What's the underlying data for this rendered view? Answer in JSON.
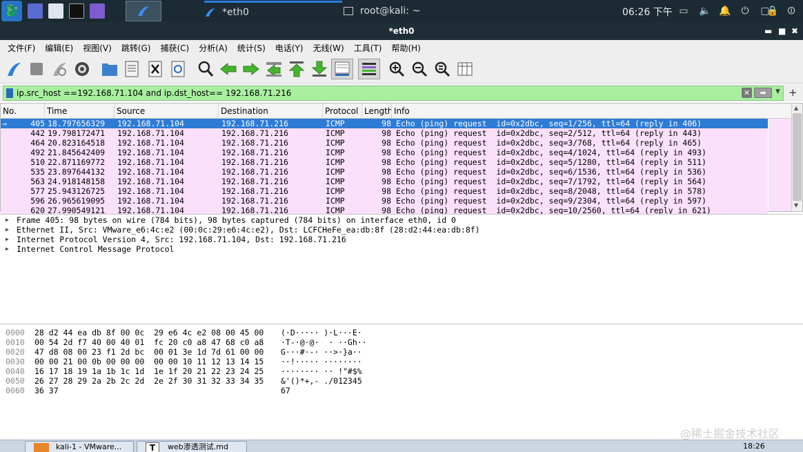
{
  "panel": {
    "task1": "*eth0",
    "task2": "root@kali: ~",
    "clock": "06:26 下午"
  },
  "window": {
    "title": "*eth0",
    "minimize": "▬",
    "maximize": "■",
    "close": "✖"
  },
  "menu": [
    "文件(F)",
    "编辑(E)",
    "视图(V)",
    "跳转(G)",
    "捕获(C)",
    "分析(A)",
    "统计(S)",
    "电话(Y)",
    "无线(W)",
    "工具(T)",
    "帮助(H)"
  ],
  "toolbar_icons": [
    "start-capture-icon",
    "stop-capture-icon",
    "restart-capture-icon",
    "capture-options-icon",
    "open-file-icon",
    "save-file-icon",
    "close-file-icon",
    "reload-file-icon",
    "find-packet-icon",
    "go-back-icon",
    "go-forward-icon",
    "go-to-packet-icon",
    "go-first-icon",
    "go-last-icon",
    "auto-scroll-icon",
    "colorize-icon",
    "zoom-in-icon",
    "zoom-out-icon",
    "normal-size-icon",
    "resize-columns-icon"
  ],
  "filter": {
    "value": "ip.src_host ==192.168.71.104 and ip.dst_host== 192.168.71.216",
    "plus": "+"
  },
  "packet_list": {
    "columns": [
      "No.",
      "Time",
      "Source",
      "Destination",
      "Protocol",
      "Length",
      "Info"
    ],
    "rows": [
      {
        "no": "405",
        "time": "18.797656329",
        "src": "192.168.71.104",
        "dst": "192.168.71.216",
        "proto": "ICMP",
        "len": "98",
        "info": "Echo (ping) request  id=0x2dbc, seq=1/256, ttl=64 (reply in 406)",
        "selected": true
      },
      {
        "no": "442",
        "time": "19.798172471",
        "src": "192.168.71.104",
        "dst": "192.168.71.216",
        "proto": "ICMP",
        "len": "98",
        "info": "Echo (ping) request  id=0x2dbc, seq=2/512, ttl=64 (reply in 443)"
      },
      {
        "no": "464",
        "time": "20.823164518",
        "src": "192.168.71.104",
        "dst": "192.168.71.216",
        "proto": "ICMP",
        "len": "98",
        "info": "Echo (ping) request  id=0x2dbc, seq=3/768, ttl=64 (reply in 465)"
      },
      {
        "no": "492",
        "time": "21.845642409",
        "src": "192.168.71.104",
        "dst": "192.168.71.216",
        "proto": "ICMP",
        "len": "98",
        "info": "Echo (ping) request  id=0x2dbc, seq=4/1024, ttl=64 (reply in 493)"
      },
      {
        "no": "510",
        "time": "22.871169772",
        "src": "192.168.71.104",
        "dst": "192.168.71.216",
        "proto": "ICMP",
        "len": "98",
        "info": "Echo (ping) request  id=0x2dbc, seq=5/1280, ttl=64 (reply in 511)"
      },
      {
        "no": "535",
        "time": "23.897644132",
        "src": "192.168.71.104",
        "dst": "192.168.71.216",
        "proto": "ICMP",
        "len": "98",
        "info": "Echo (ping) request  id=0x2dbc, seq=6/1536, ttl=64 (reply in 536)"
      },
      {
        "no": "563",
        "time": "24.918148158",
        "src": "192.168.71.104",
        "dst": "192.168.71.216",
        "proto": "ICMP",
        "len": "98",
        "info": "Echo (ping) request  id=0x2dbc, seq=7/1792, ttl=64 (reply in 564)"
      },
      {
        "no": "577",
        "time": "25.943126725",
        "src": "192.168.71.104",
        "dst": "192.168.71.216",
        "proto": "ICMP",
        "len": "98",
        "info": "Echo (ping) request  id=0x2dbc, seq=8/2048, ttl=64 (reply in 578)"
      },
      {
        "no": "596",
        "time": "26.965619095",
        "src": "192.168.71.104",
        "dst": "192.168.71.216",
        "proto": "ICMP",
        "len": "98",
        "info": "Echo (ping) request  id=0x2dbc, seq=9/2304, ttl=64 (reply in 597)"
      },
      {
        "no": "620",
        "time": "27.990549121",
        "src": "192.168.71.104",
        "dst": "192.168.71.216",
        "proto": "ICMP",
        "len": "98",
        "info": "Echo (ping) request  id=0x2dbc, seq=10/2560, ttl=64 (reply in 621)"
      }
    ]
  },
  "details": [
    "Frame 405: 98 bytes on wire (784 bits), 98 bytes captured (784 bits) on interface eth0, id 0",
    "Ethernet II, Src: VMware_e6:4c:e2 (00:0c:29:e6:4c:e2), Dst: LCFCHeFe_ea:db:8f (28:d2:44:ea:db:8f)",
    "Internet Protocol Version 4, Src: 192.168.71.104, Dst: 192.168.71.216",
    "Internet Control Message Protocol"
  ],
  "bytes": [
    {
      "off": "0000",
      "hex": "28 d2 44 ea db 8f 00 0c  29 e6 4c e2 08 00 45 00",
      "ascii": "(·D····· )·L···E·"
    },
    {
      "off": "0010",
      "hex": "00 54 2d f7 40 00 40 01  fc 20 c0 a8 47 68 c0 a8",
      "ascii": "·T-·@·@·  · ··Gh··"
    },
    {
      "off": "0020",
      "hex": "47 d8 08 00 23 f1 2d bc  00 01 3e 1d 7d 61 00 00",
      "ascii": "G···#·-· ··>·}a··"
    },
    {
      "off": "0030",
      "hex": "00 00 21 00 0b 00 00 00  00 00 10 11 12 13 14 15",
      "ascii": "··!····· ········"
    },
    {
      "off": "0040",
      "hex": "16 17 18 19 1a 1b 1c 1d  1e 1f 20 21 22 23 24 25",
      "ascii": "········ ·· !\"#$%"
    },
    {
      "off": "0050",
      "hex": "26 27 28 29 2a 2b 2c 2d  2e 2f 30 31 32 33 34 35",
      "ascii": "&'()*+,- ./012345"
    },
    {
      "off": "0060",
      "hex": "36 37",
      "ascii": "67"
    }
  ],
  "taskbar": {
    "item1": "kali-1 - VMware...",
    "item2": "web渗透测试.md",
    "clock": "18:26"
  },
  "watermark": "@稀土掘金技术社区",
  "colors": {
    "selected_row": "#2d7bd5",
    "icmp_row": "#fbe0fb",
    "filter_ok": "#a8f0a0",
    "panel": "#1b2a33"
  }
}
